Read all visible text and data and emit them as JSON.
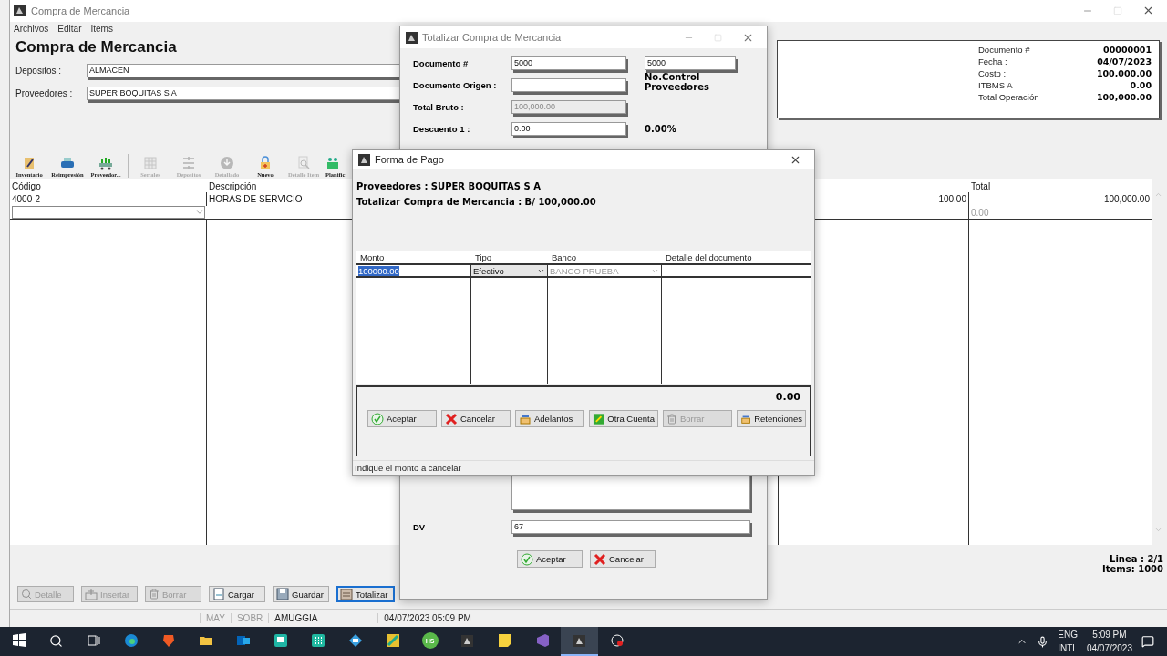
{
  "main_window": {
    "title": "Compra de Mercancia",
    "menu": [
      "Archivos",
      "Editar",
      "Items"
    ],
    "heading": "Compra de Mercancia",
    "fields": [
      {
        "label": "Depositos :",
        "value": "ALMACEN"
      },
      {
        "label": "Proveedores :",
        "value": "SUPER BOQUITAS S A"
      }
    ],
    "summary": [
      {
        "label": "Documento #",
        "value": "00000001"
      },
      {
        "label": "Fecha :",
        "value": "04/07/2023"
      },
      {
        "label": "Costo :",
        "value": "100,000.00"
      },
      {
        "label": "ITBMS A",
        "value": "0.00"
      },
      {
        "label": "Total Operación",
        "value": "100,000.00"
      }
    ],
    "toolbar": [
      {
        "label": "Inventario",
        "kind": "clipboard",
        "disabled": false
      },
      {
        "label": "Reimpresión",
        "kind": "printer",
        "disabled": false
      },
      {
        "label": "Proveedor...",
        "kind": "truck",
        "disabled": false
      },
      {
        "kind": "separator"
      },
      {
        "label": "Seriales",
        "kind": "grid",
        "disabled": true
      },
      {
        "label": "Depositos",
        "kind": "lines",
        "disabled": true
      },
      {
        "label": "Detallado",
        "kind": "disc",
        "disabled": true
      },
      {
        "label": "Nuevo",
        "kind": "lock",
        "disabled": false
      },
      {
        "label": "Detalle Item",
        "kind": "magnifier",
        "disabled": true
      },
      {
        "label": "Planific",
        "kind": "people",
        "disabled": false
      }
    ],
    "grid": {
      "columns": {
        "column_1": "Código",
        "column_2": "Descripción",
        "column_5": "Total"
      },
      "rows": [
        {
          "kind": "data",
          "cells": {
            "column_1": "4000-2",
            "column_2": "HORAS DE SERVICIO",
            "column_4": "100.00",
            "column_5": "100,000.00"
          }
        },
        {
          "kind": "input",
          "cells": {
            "column_5": "0.00"
          }
        }
      ]
    },
    "counters": [
      "Linea : 2/1",
      "Items: 1000"
    ],
    "buttons": [
      {
        "label": "Detalle",
        "kind": "search",
        "disabled": true,
        "focused": false
      },
      {
        "label": "Insertar",
        "kind": "insert",
        "disabled": true,
        "focused": false
      },
      {
        "label": "Borrar",
        "kind": "trash",
        "disabled": true,
        "focused": false
      },
      {
        "label": "Cargar",
        "kind": "load",
        "disabled": false,
        "focused": false
      },
      {
        "label": "Guardar",
        "kind": "save",
        "disabled": false,
        "focused": false
      },
      {
        "label": "Totalizar",
        "kind": "total",
        "disabled": false,
        "focused": true
      }
    ],
    "status_bar": [
      {
        "text": "MAY",
        "disabled": true
      },
      {
        "text": "SOBR",
        "disabled": true
      },
      {
        "text": "AMUGGIA",
        "disabled": false
      },
      {
        "text": "04/07/2023 05:09 PM",
        "disabled": false
      }
    ]
  },
  "totalizar_dialog": {
    "title": "Totalizar Compra de Mercancia",
    "fields": [
      {
        "label": "Documento #",
        "value": "5000",
        "disabled": false
      },
      {
        "label": "Documento Origen :",
        "disabled": false
      },
      {
        "label": "Total Bruto :",
        "value": "100,000.00",
        "disabled": true
      },
      {
        "label": "Descuento 1 :",
        "value": "0.00",
        "percent": "0.00%",
        "disabled": false
      }
    ],
    "control_number": {
      "value": "5000",
      "label": "No.Control Proveedores"
    },
    "dv": {
      "label": "DV",
      "value": "67"
    },
    "buttons": [
      {
        "label": "Aceptar",
        "kind": "accept"
      },
      {
        "label": "Cancelar",
        "kind": "cancel"
      }
    ]
  },
  "payment_dialog": {
    "title": "Forma de Pago",
    "info": [
      "Proveedores  : SUPER BOQUITAS S A",
      "Totalizar Compra de Mercancia  : B/ 100,000.00"
    ],
    "columns": [
      "Monto",
      "Tipo",
      "Banco",
      "Detalle del documento"
    ],
    "row": {
      "monto": "100000.00",
      "monto_selected": true,
      "tipo": "Efectivo",
      "banco": "BANCO PRUEBA",
      "banco_disabled": true
    },
    "total": "0.00",
    "buttons": [
      {
        "label": "Aceptar",
        "kind": "accept",
        "disabled": false
      },
      {
        "label": "Cancelar",
        "kind": "cancel",
        "disabled": false
      },
      {
        "label": "Adelantos",
        "kind": "transfer",
        "disabled": false
      },
      {
        "label": "Otra Cuenta",
        "kind": "account",
        "disabled": false
      },
      {
        "label": "Borrar",
        "kind": "trash",
        "disabled": true
      },
      {
        "label": "Retenciones",
        "kind": "transfer",
        "disabled": false
      }
    ],
    "status": "Indique el monto a cancelar"
  },
  "taskbar": {
    "apps": [
      {
        "kind": "start",
        "selected": false
      },
      {
        "kind": "search",
        "selected": false
      },
      {
        "kind": "taskview",
        "selected": false
      },
      {
        "kind": "edge",
        "selected": false
      },
      {
        "kind": "shield",
        "selected": false
      },
      {
        "kind": "folder",
        "selected": false
      },
      {
        "kind": "mail",
        "selected": false
      },
      {
        "kind": "monitor",
        "selected": false
      },
      {
        "kind": "dots",
        "selected": false
      },
      {
        "kind": "diamond",
        "selected": false
      },
      {
        "kind": "tools",
        "selected": false
      },
      {
        "kind": "badge",
        "label": "HS",
        "selected": false
      },
      {
        "kind": "app",
        "selected": false
      },
      {
        "kind": "note",
        "selected": false
      },
      {
        "kind": "ribbon",
        "selected": false
      },
      {
        "kind": "app",
        "selected": true
      },
      {
        "kind": "record",
        "selected": false
      }
    ],
    "language": "ENG",
    "layout": "INTL",
    "time": "5:09 PM",
    "date": "04/07/2023"
  }
}
